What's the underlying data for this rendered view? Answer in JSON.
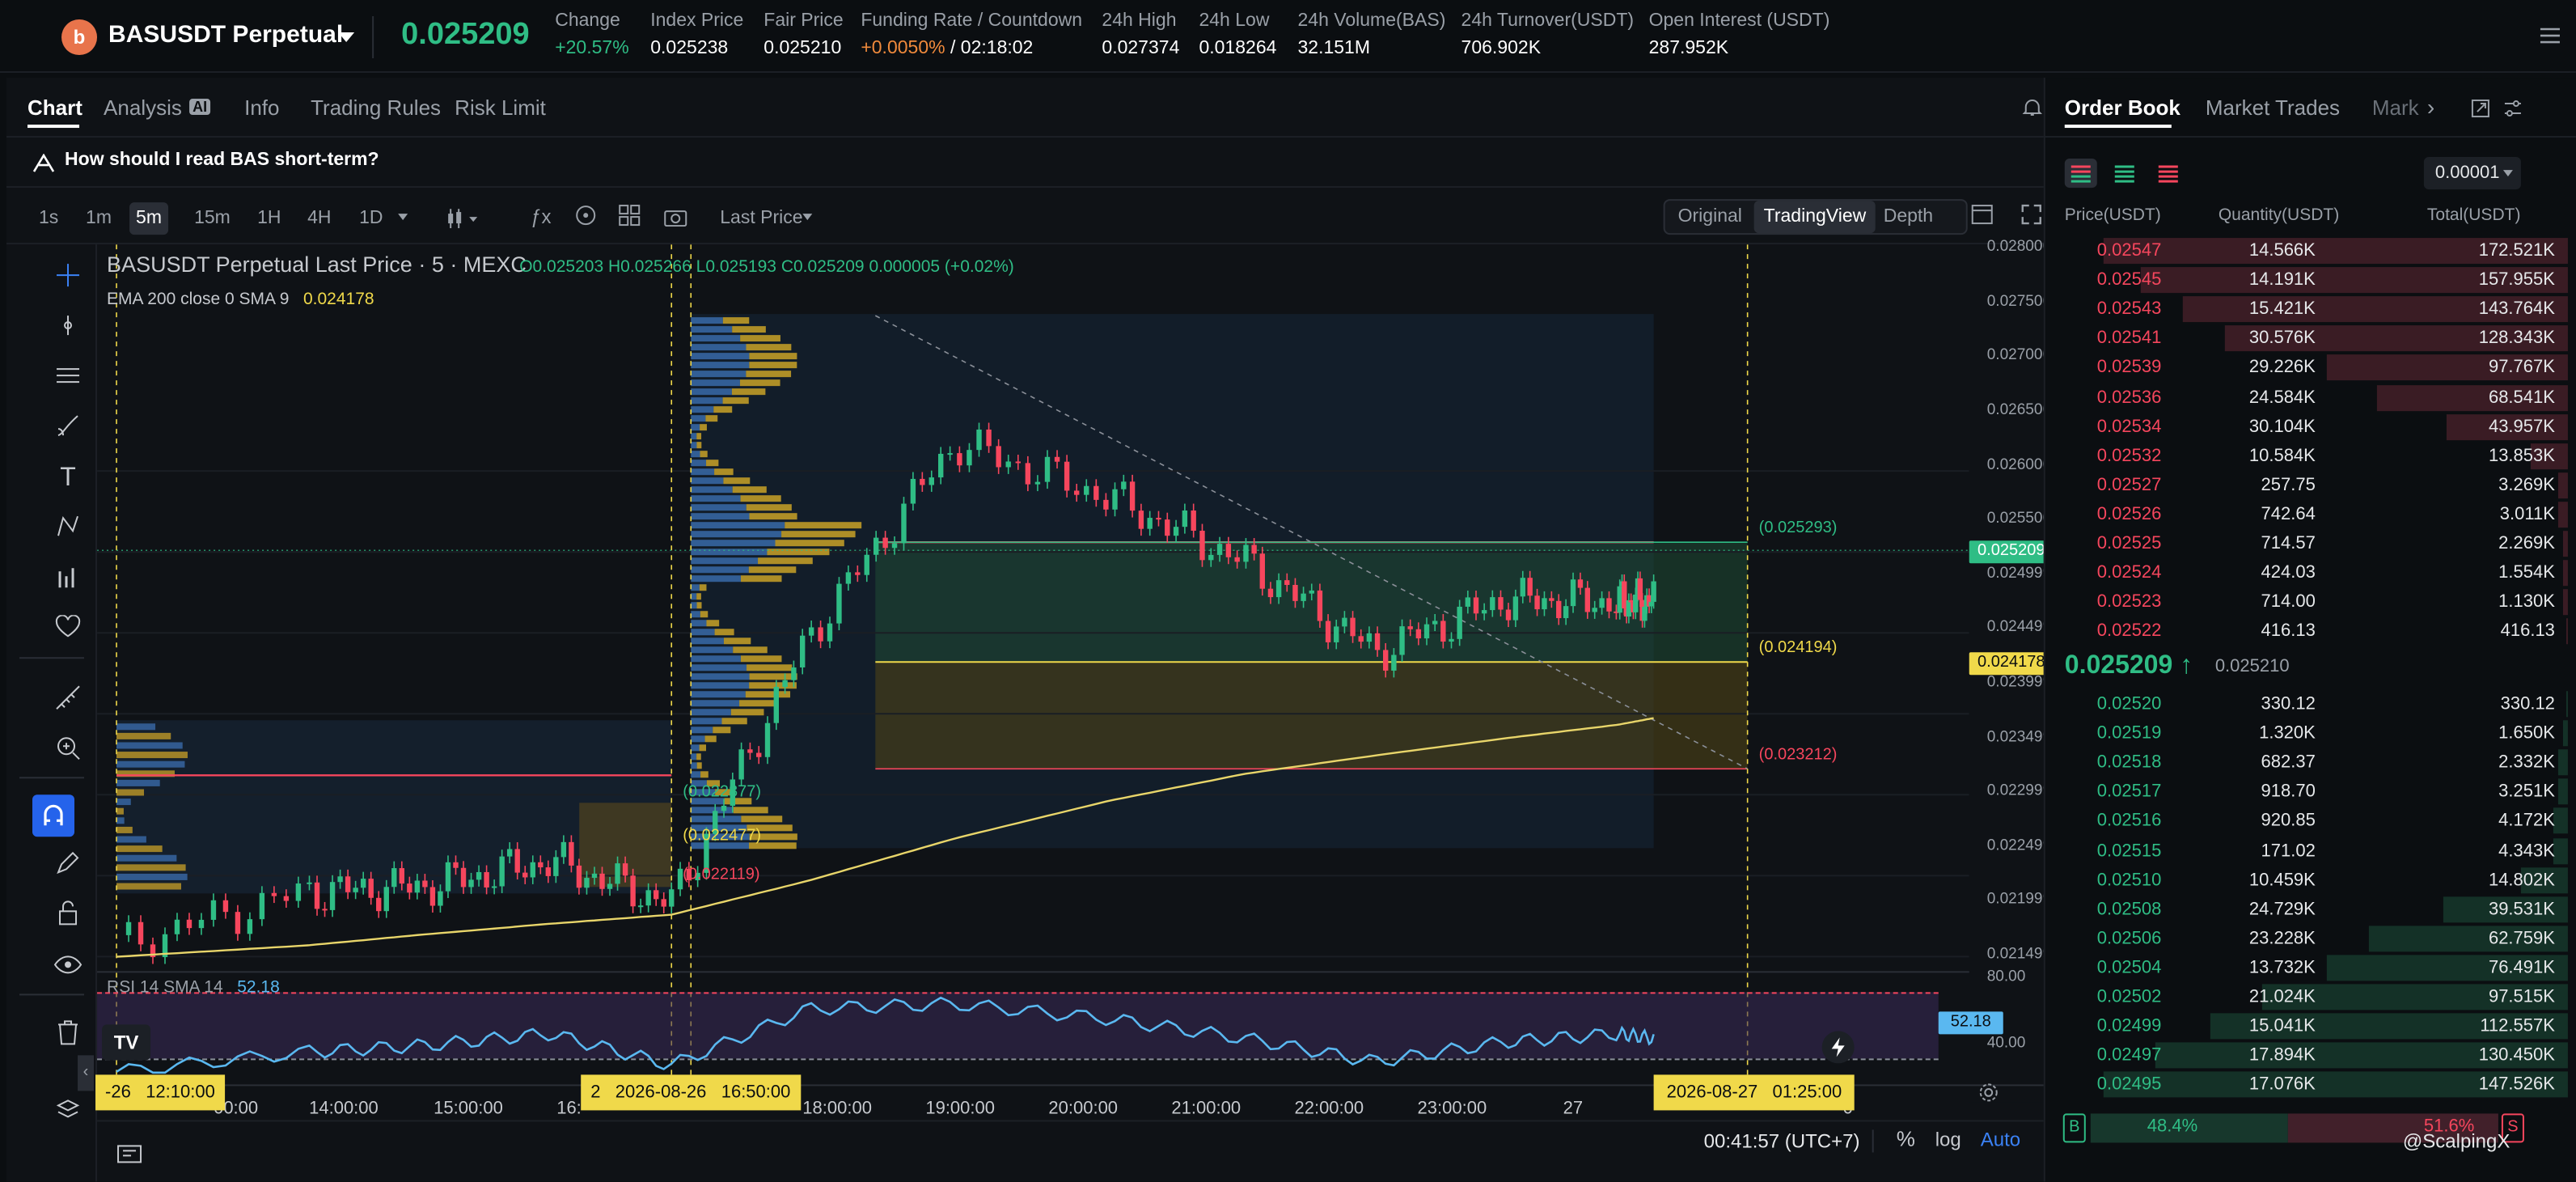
{
  "header": {
    "coin_glyph": "b",
    "symbol": "BASUSDT Perpetual",
    "last_price": "0.025209",
    "stats": [
      {
        "label": "Change",
        "value": "+20.57%",
        "color": "#2fbd85"
      },
      {
        "label": "Index Price",
        "value": "0.025238"
      },
      {
        "label": "Fair Price",
        "value": "0.025210"
      },
      {
        "label": "Funding Rate",
        "label2": "Countdown",
        "value": "+0.0050%",
        "value2": "02:18:02"
      },
      {
        "label": "24h High",
        "value": "0.027374"
      },
      {
        "label": "24h Low",
        "value": "0.018264"
      },
      {
        "label": "24h Volume(BAS)",
        "value": "32.151M"
      },
      {
        "label": "24h Turnover(USDT)",
        "value": "706.902K"
      },
      {
        "label": "Open Interest (USDT)",
        "value": "287.952K"
      }
    ]
  },
  "chart_tabs": [
    "Chart",
    "Analysis",
    "Info",
    "Trading Rules",
    "Risk Limit"
  ],
  "analysis_badge": "AI",
  "ai_prompt": "How should I read BAS short-term?",
  "intervals": [
    "1s",
    "1m",
    "5m",
    "15m",
    "1H",
    "4H",
    "1D"
  ],
  "selected_interval": "5m",
  "price_type": "Last Price",
  "views": [
    "Original",
    "TradingView",
    "Depth"
  ],
  "selected_view": "TradingView",
  "chart": {
    "legend_title": "BASUSDT Perpetual Last Price · 5 · MEXC",
    "ohlc": {
      "o": "O0.025203",
      "h": "H0.025266",
      "l": "L0.025193",
      "c": "C0.025209",
      "chg": "0.000005 (+0.02%)"
    },
    "ema_label": "EMA 200 close 0 SMA 9",
    "ema_value": "0.024178",
    "rsi_label": "RSI 14 SMA 14",
    "rsi_value": "52.18",
    "y_ticks": [
      "0.028000",
      "0.027500",
      "0.027000",
      "0.026500",
      "0.026000",
      "0.025500",
      "0.024999",
      "0.024499",
      "0.023999",
      "0.023499",
      "0.022999",
      "0.022499",
      "0.021999",
      "0.021499"
    ],
    "rsi_ticks": [
      "80.00",
      "40.00"
    ],
    "current_price_tag": "0.025209",
    "ema_tag": "0.024178",
    "rsi_tag": "52.18",
    "levels": [
      {
        "text": "(0.025293)",
        "color": "#2fbd85"
      },
      {
        "text": "(0.024194)",
        "color": "#f0d94a"
      },
      {
        "text": "(0.023212)",
        "color": "#f6465d"
      },
      {
        "text": "(0.022877)",
        "color": "#2fbd85"
      },
      {
        "text": "(0.022477)",
        "color": "#f0d94a"
      },
      {
        "text": "(0.022119)",
        "color": "#f6465d"
      }
    ],
    "x_ticks": [
      "00:00",
      "14:00:00",
      "15:00:00",
      "16:",
      "18:00:00",
      "19:00:00",
      "20:00:00",
      "21:00:00",
      "22:00:00",
      "23:00:00",
      "27",
      "0"
    ],
    "x_markers": [
      "-26   12:10:00",
      "2   2026-08-26   16:50:00",
      "2026-08-27   01:25:00"
    ],
    "footer_time": "00:41:57 (UTC+7)",
    "footer_opts": [
      "%",
      "log",
      "Auto"
    ],
    "tv_logo": "TV"
  },
  "chart_data": {
    "type": "candlestick",
    "x": [
      "12:10",
      "14:00",
      "15:00",
      "16:00",
      "16:50",
      "18:00",
      "19:00",
      "20:00",
      "21:00",
      "22:00",
      "23:00",
      "27",
      "01:25"
    ],
    "close": [
      0.02218,
      0.02265,
      0.0227,
      0.02292,
      0.02255,
      0.0249,
      0.0266,
      0.02612,
      0.02555,
      0.02476,
      0.02522,
      0.0252,
      0.025209
    ],
    "ema200": [
      0.02208,
      0.02218,
      0.02228,
      0.02237,
      0.02245,
      0.02275,
      0.02312,
      0.02345,
      0.02369,
      0.02385,
      0.024,
      0.02412,
      0.024178
    ],
    "rsi": [
      32,
      44,
      48,
      55,
      36,
      70,
      73,
      64,
      52,
      38,
      50,
      55,
      52.18
    ],
    "ylim": [
      0.0211,
      0.0282
    ]
  },
  "orderbook": {
    "tabs": [
      "Order Book",
      "Market Trades",
      "Mark"
    ],
    "precision": "0.00001",
    "headers": [
      "Price(USDT)",
      "Quantity(USDT)",
      "Total(USDT)"
    ],
    "asks": [
      {
        "p": "0.02547",
        "q": "14.566K",
        "t": "172.521K",
        "d": 1.0
      },
      {
        "p": "0.02545",
        "q": "14.191K",
        "t": "157.955K",
        "d": 0.92
      },
      {
        "p": "0.02543",
        "q": "15.421K",
        "t": "143.764K",
        "d": 0.83
      },
      {
        "p": "0.02541",
        "q": "30.576K",
        "t": "128.343K",
        "d": 0.74
      },
      {
        "p": "0.02539",
        "q": "29.226K",
        "t": "97.767K",
        "d": 0.52
      },
      {
        "p": "0.02536",
        "q": "24.584K",
        "t": "68.541K",
        "d": 0.41
      },
      {
        "p": "0.02534",
        "q": "30.104K",
        "t": "43.957K",
        "d": 0.26
      },
      {
        "p": "0.02532",
        "q": "10.584K",
        "t": "13.853K",
        "d": 0.08
      },
      {
        "p": "0.02527",
        "q": "257.75",
        "t": "3.269K",
        "d": 0.02
      },
      {
        "p": "0.02526",
        "q": "742.64",
        "t": "3.011K",
        "d": 0.02
      },
      {
        "p": "0.02525",
        "q": "714.57",
        "t": "2.269K",
        "d": 0.01
      },
      {
        "p": "0.02524",
        "q": "424.03",
        "t": "1.554K",
        "d": 0.01
      },
      {
        "p": "0.02523",
        "q": "714.00",
        "t": "1.130K",
        "d": 0.01
      },
      {
        "p": "0.02522",
        "q": "416.13",
        "t": "416.13",
        "d": 0.005
      }
    ],
    "mid_price": "0.025209",
    "mid_arrow": "↑",
    "mid_fair": "0.025210",
    "bids": [
      {
        "p": "0.02520",
        "q": "330.12",
        "t": "330.12",
        "d": 0.003
      },
      {
        "p": "0.02519",
        "q": "1.320K",
        "t": "1.650K",
        "d": 0.01
      },
      {
        "p": "0.02518",
        "q": "682.37",
        "t": "2.332K",
        "d": 0.02
      },
      {
        "p": "0.02517",
        "q": "918.70",
        "t": "3.251K",
        "d": 0.02
      },
      {
        "p": "0.02516",
        "q": "920.85",
        "t": "4.172K",
        "d": 0.03
      },
      {
        "p": "0.02515",
        "q": "171.02",
        "t": "4.343K",
        "d": 0.03
      },
      {
        "p": "0.02510",
        "q": "10.459K",
        "t": "14.802K",
        "d": 0.1
      },
      {
        "p": "0.02508",
        "q": "24.729K",
        "t": "39.531K",
        "d": 0.27
      },
      {
        "p": "0.02506",
        "q": "23.228K",
        "t": "62.759K",
        "d": 0.43
      },
      {
        "p": "0.02504",
        "q": "13.732K",
        "t": "76.491K",
        "d": 0.52
      },
      {
        "p": "0.02502",
        "q": "21.024K",
        "t": "97.515K",
        "d": 0.66
      },
      {
        "p": "0.02499",
        "q": "15.041K",
        "t": "112.557K",
        "d": 0.77
      },
      {
        "p": "0.02497",
        "q": "17.894K",
        "t": "130.450K",
        "d": 0.89
      },
      {
        "p": "0.02495",
        "q": "17.076K",
        "t": "147.526K",
        "d": 1.0
      }
    ],
    "buy_label": "B",
    "buy_pct": "48.4%",
    "sell_pct": "51.6%",
    "sell_label": "S",
    "watermark": "@ScalpingX"
  },
  "colors": {
    "green": "#2fbd85",
    "red": "#f6465d",
    "yellow": "#f0d94a",
    "accent": "#3b82f6"
  }
}
